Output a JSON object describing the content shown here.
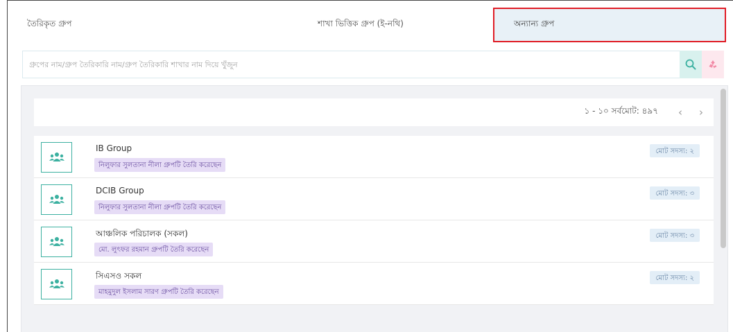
{
  "tabs": [
    {
      "label": "তৈরিকৃত গ্রুপ"
    },
    {
      "label": "শাখা ভিত্তিক গ্রুপ (ই-নথি)"
    },
    {
      "label": "অন্যান্য গ্রুপ"
    }
  ],
  "search": {
    "placeholder": "গ্রুপের নাম/গ্রুপ তৈরিকারি নাম/গ্রুপ তৈরিকারি শাখার নাম দিয়ে খুঁজুন",
    "search_icon": "search-icon",
    "reset_icon": "recycle-icon"
  },
  "pager": {
    "summary": "১ - ১০ সর্বমোট: ৪৯৭",
    "prev": "‹",
    "next": "›"
  },
  "groups": [
    {
      "name": "IB Group",
      "creator": "নিলুফার সুলতানা নীলা গ্রুপটি তৈরি করেছেন",
      "members": "মোট সদস্য: ২"
    },
    {
      "name": "DCIB Group",
      "creator": "নিলুফার সুলতানা নীলা গ্রুপটি তৈরি করেছেন",
      "members": "মোট সদস্য: ৩"
    },
    {
      "name": "আঞ্চলিক পরিচালক (সকল)",
      "creator": "মো. লুৎফর রহমান গ্রুপটি তৈরি করেছেন",
      "members": "মোট সদস্য: ৩"
    },
    {
      "name": "সিএসও সকল",
      "creator": "মাহমুদুল ইসলাম সারণ গ্রুপটি তৈরি করেছেন",
      "members": "মোট সদস্য: ২"
    }
  ],
  "colors": {
    "accent": "#3bb0a0",
    "highlight_border": "#e01b24"
  }
}
